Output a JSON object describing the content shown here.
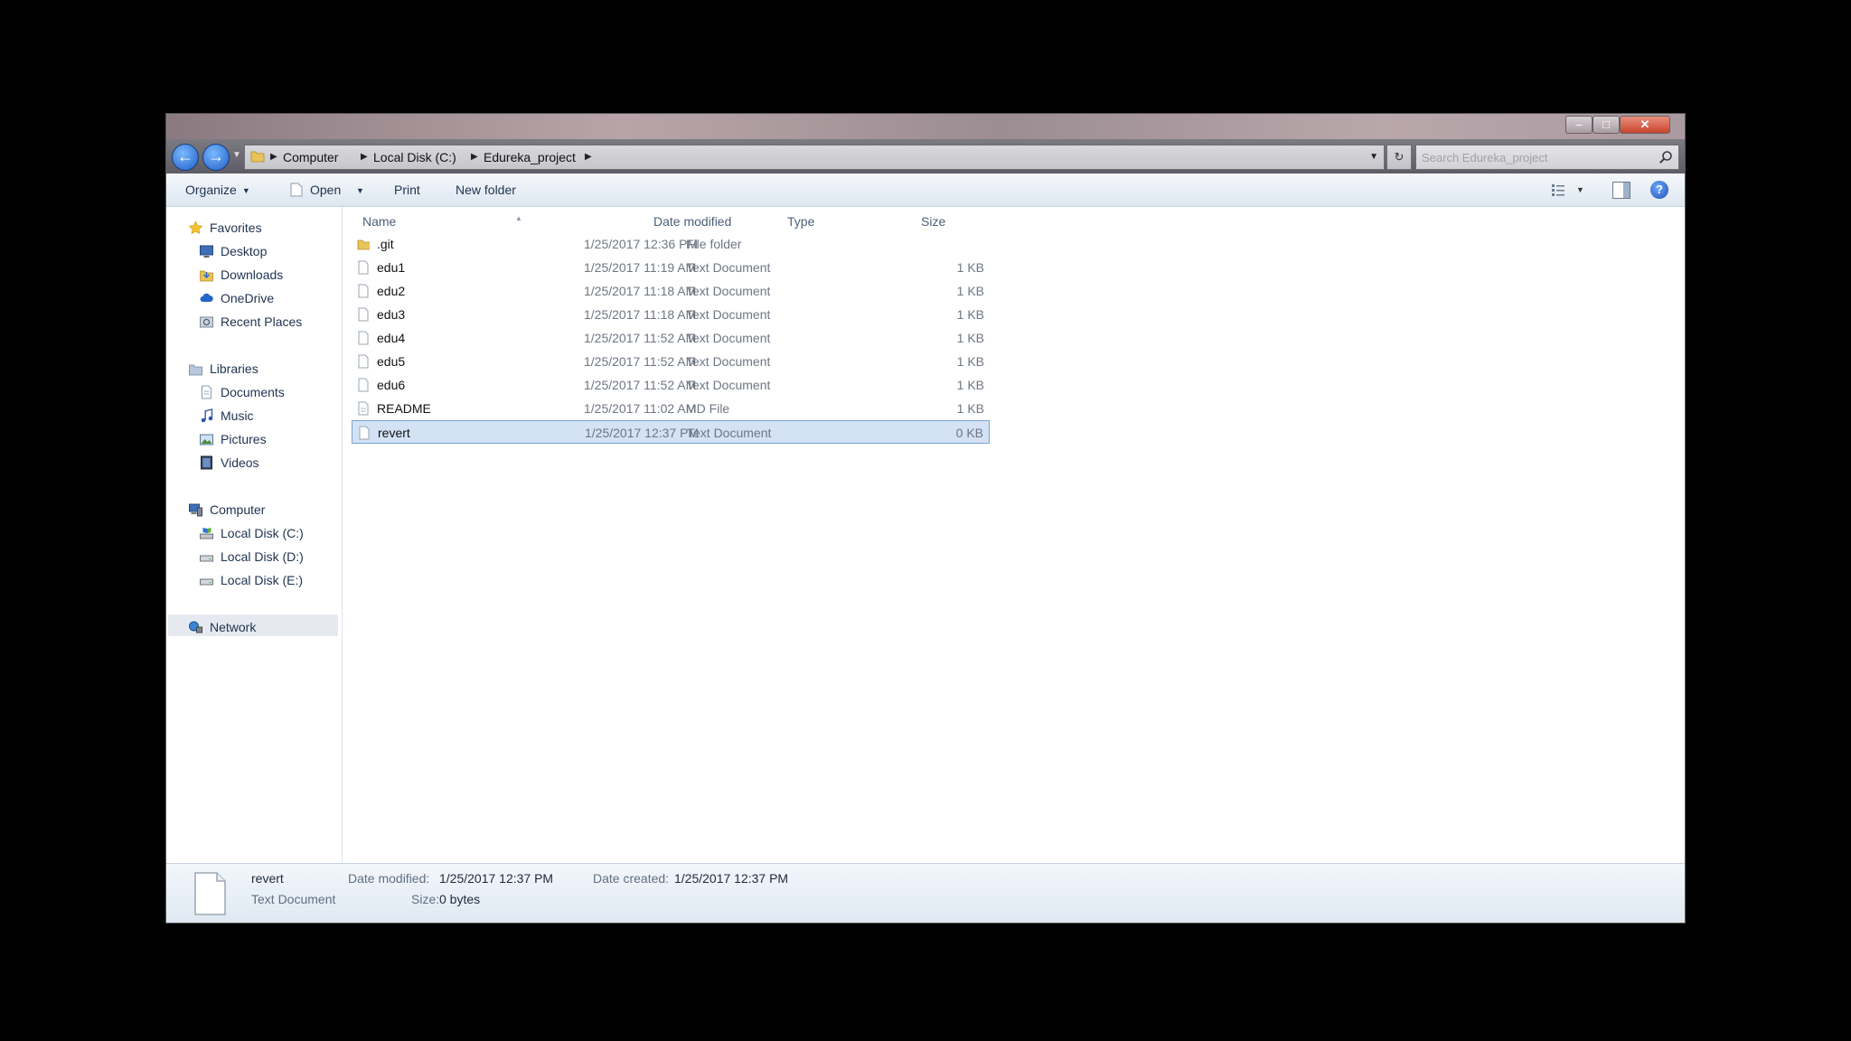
{
  "window": {
    "controls": {
      "minimize": "–",
      "maximize": "□",
      "close": "✕"
    }
  },
  "address": {
    "crumbs": [
      "Computer",
      "Local Disk (C:)",
      "Edureka_project"
    ],
    "separator": "▶",
    "dropdown": "▼",
    "refresh": "↻",
    "search_placeholder": "Search Edureka_project"
  },
  "toolbar": {
    "organize": "Organize",
    "open": "Open",
    "print": "Print",
    "new_folder": "New folder",
    "arrow": "▼"
  },
  "nav": {
    "favorites": {
      "label": "Favorites",
      "items": [
        "Desktop",
        "Downloads",
        "OneDrive",
        "Recent Places"
      ]
    },
    "libraries": {
      "label": "Libraries",
      "items": [
        "Documents",
        "Music",
        "Pictures",
        "Videos"
      ]
    },
    "computer": {
      "label": "Computer",
      "items": [
        "Local Disk (C:)",
        "Local Disk (D:)",
        "Local Disk (E:)"
      ]
    },
    "network": {
      "label": "Network"
    }
  },
  "columns": {
    "name": "Name",
    "date": "Date modified",
    "type": "Type",
    "size": "Size",
    "sort_indicator": "▲"
  },
  "files": [
    {
      "name": ".git",
      "date": "1/25/2017 12:36 PM",
      "type": "File folder",
      "size": "",
      "kind": "folder"
    },
    {
      "name": "edu1",
      "date": "1/25/2017 11:19 AM",
      "type": "Text Document",
      "size": "1 KB",
      "kind": "text"
    },
    {
      "name": "edu2",
      "date": "1/25/2017 11:18 AM",
      "type": "Text Document",
      "size": "1 KB",
      "kind": "text"
    },
    {
      "name": "edu3",
      "date": "1/25/2017 11:18 AM",
      "type": "Text Document",
      "size": "1 KB",
      "kind": "text"
    },
    {
      "name": "edu4",
      "date": "1/25/2017 11:52 AM",
      "type": "Text Document",
      "size": "1 KB",
      "kind": "text"
    },
    {
      "name": "edu5",
      "date": "1/25/2017 11:52 AM",
      "type": "Text Document",
      "size": "1 KB",
      "kind": "text"
    },
    {
      "name": "edu6",
      "date": "1/25/2017 11:52 AM",
      "type": "Text Document",
      "size": "1 KB",
      "kind": "text"
    },
    {
      "name": "README",
      "date": "1/25/2017 11:02 AM",
      "type": "MD File",
      "size": "1 KB",
      "kind": "md"
    },
    {
      "name": "revert",
      "date": "1/25/2017 12:37 PM",
      "type": "Text Document",
      "size": "0 KB",
      "kind": "text",
      "selected": true
    }
  ],
  "details": {
    "name": "revert",
    "type": "Text Document",
    "date_modified_label": "Date modified:",
    "date_modified": "1/25/2017 12:37 PM",
    "date_created_label": "Date created:",
    "date_created": "1/25/2017 12:37 PM",
    "size_label": "Size:",
    "size": "0 bytes"
  },
  "colors": {
    "selection": "#d3e2f5",
    "selection_border": "#7da2ce",
    "link_text": "#1e3250",
    "title_close": "#c8452c"
  }
}
